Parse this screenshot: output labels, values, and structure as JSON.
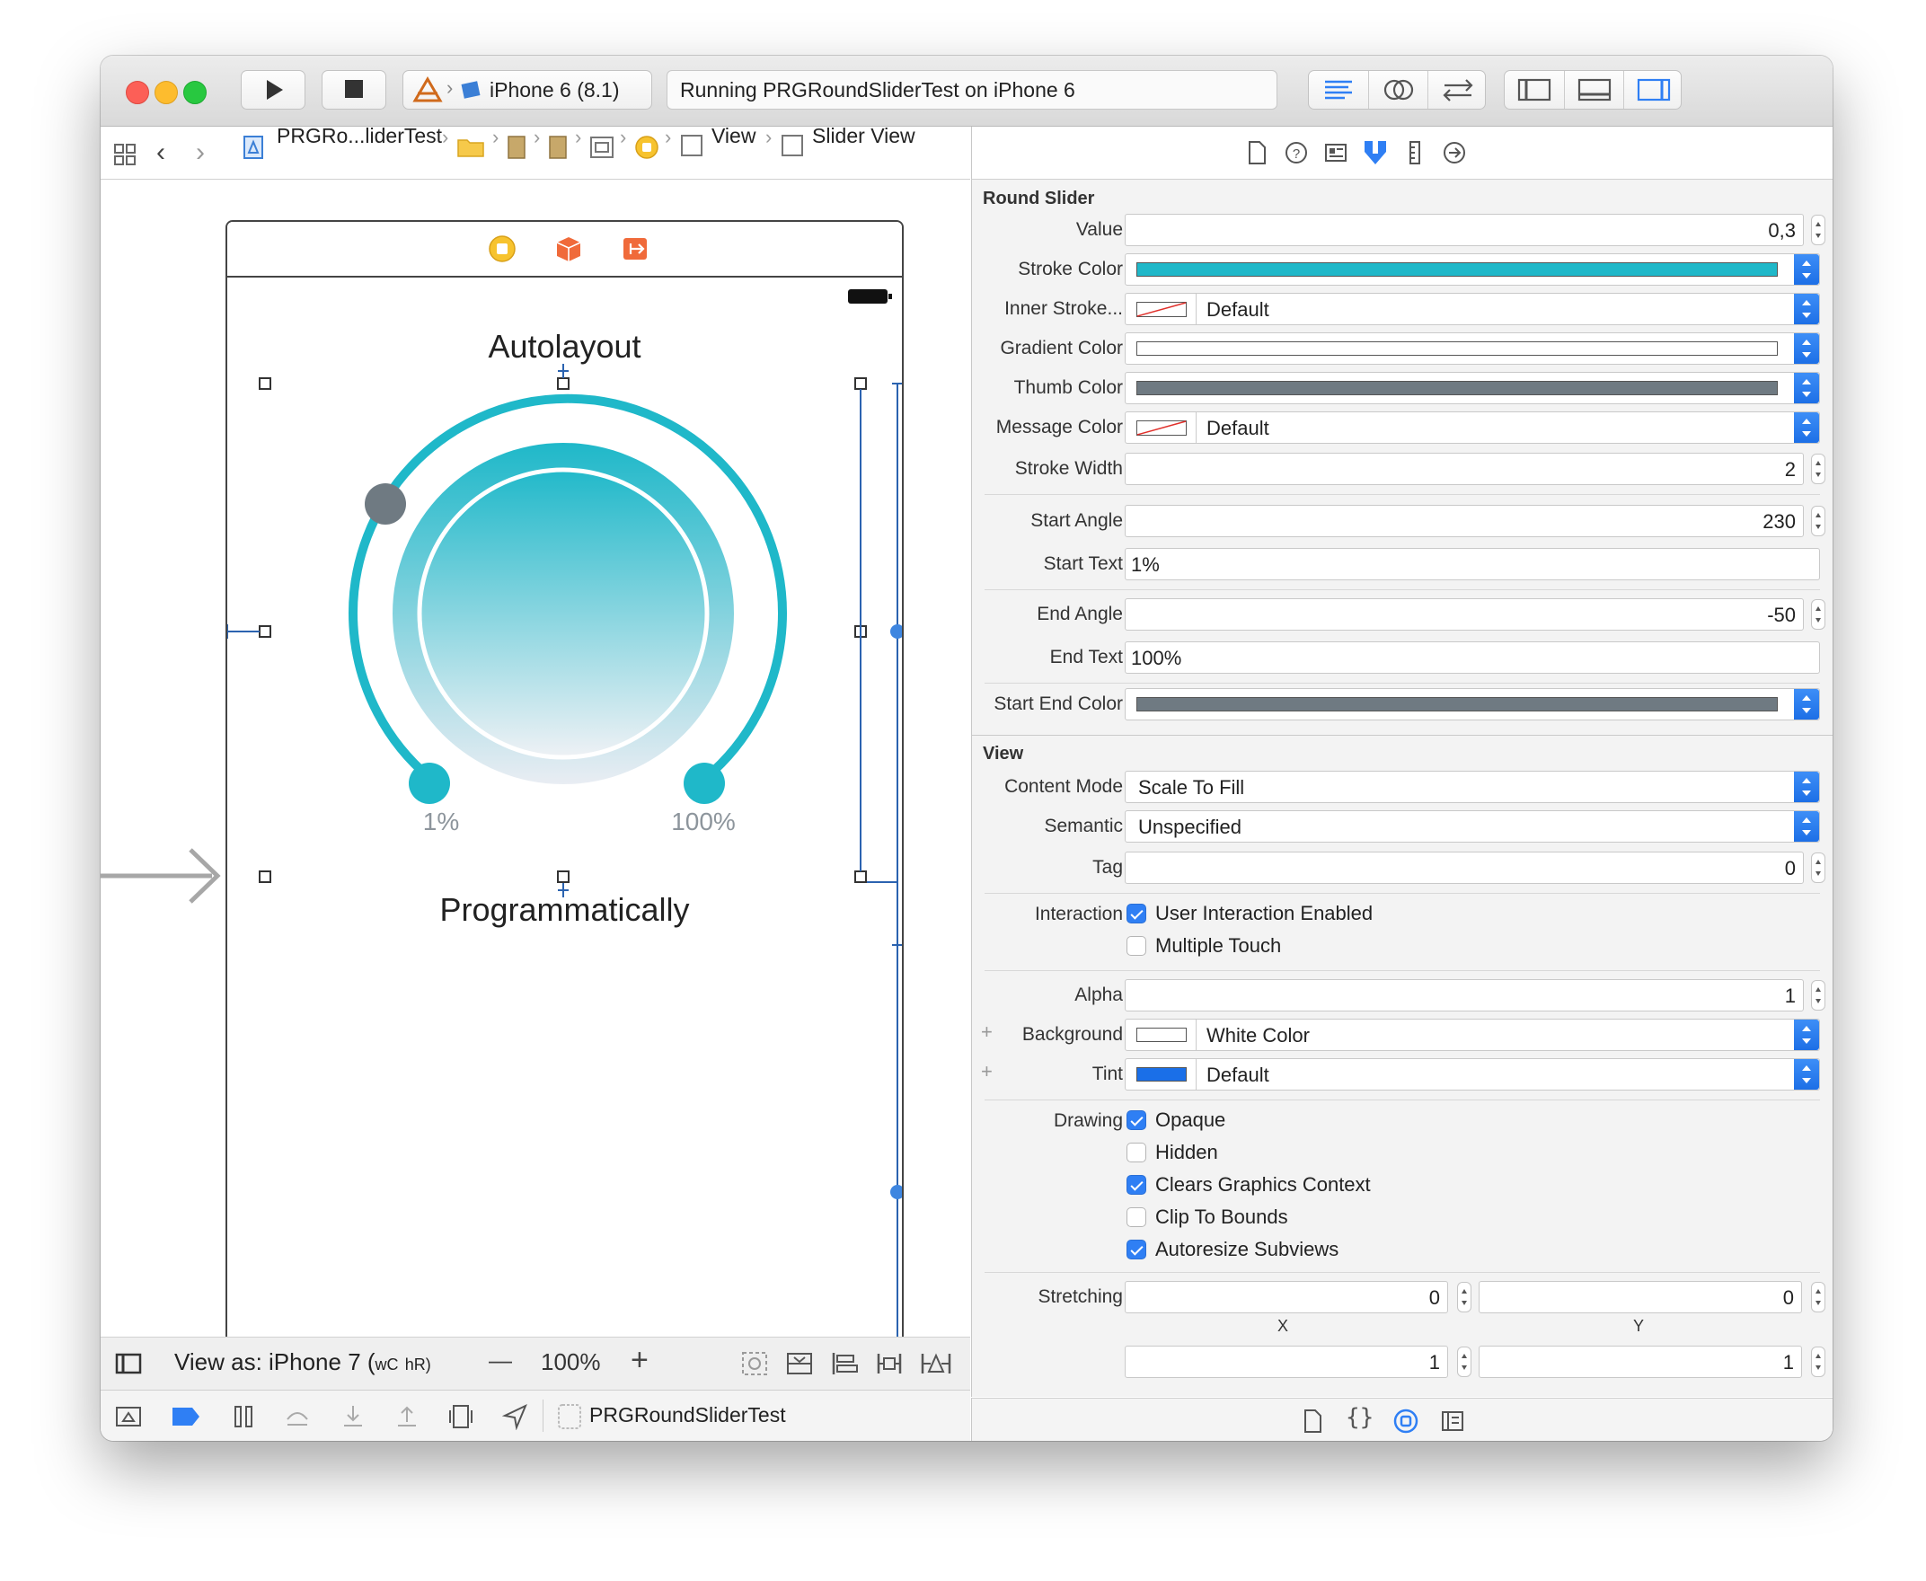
{
  "toolbar": {
    "scheme": "iPhone 6 (8.1)",
    "status": "Running PRGRoundSliderTest on iPhone 6"
  },
  "jumpbar": {
    "project": "PRGRo...liderTest",
    "view": "View",
    "slider_view": "Slider View"
  },
  "canvas": {
    "title_top": "Autolayout",
    "start_label": "1%",
    "end_label": "100%",
    "title_bottom": "Programmatically"
  },
  "bottombar": {
    "view_as": "View as: iPhone 7 (",
    "wc": "wC",
    "hr": "hR)",
    "minus": "—",
    "zoom": "100%",
    "plus": "+"
  },
  "debugbar": {
    "target": "PRGRoundSliderTest"
  },
  "inspector": {
    "round_slider": {
      "section": "Round Slider",
      "value_label": "Value",
      "value": "0,3",
      "stroke_color_label": "Stroke Color",
      "inner_stroke_label": "Inner Stroke...",
      "inner_stroke": "Default",
      "gradient_color_label": "Gradient Color",
      "thumb_color_label": "Thumb Color",
      "message_color_label": "Message Color",
      "message_color": "Default",
      "stroke_width_label": "Stroke Width",
      "stroke_width": "2",
      "start_angle_label": "Start Angle",
      "start_angle": "230",
      "start_text_label": "Start Text",
      "start_text": "1%",
      "end_angle_label": "End Angle",
      "end_angle": "-50",
      "end_text_label": "End Text",
      "end_text": "100%",
      "start_end_color_label": "Start End Color"
    },
    "view": {
      "section": "View",
      "content_mode_label": "Content Mode",
      "content_mode": "Scale To Fill",
      "semantic_label": "Semantic",
      "semantic": "Unspecified",
      "tag_label": "Tag",
      "tag": "0",
      "interaction_label": "Interaction",
      "user_interaction": "User Interaction Enabled",
      "multiple_touch": "Multiple Touch",
      "alpha_label": "Alpha",
      "alpha": "1",
      "background_label": "Background",
      "background": "White Color",
      "tint_label": "Tint",
      "tint": "Default",
      "drawing_label": "Drawing",
      "opaque": "Opaque",
      "hidden": "Hidden",
      "clears_context": "Clears Graphics Context",
      "clip_bounds": "Clip To Bounds",
      "autoresize": "Autoresize Subviews",
      "stretching_label": "Stretching",
      "stretch_x": "0",
      "stretch_y": "0",
      "x_label": "X",
      "y_label": "Y",
      "stretch_w": "1",
      "stretch_h": "1"
    }
  },
  "colors": {
    "stroke": "#1fb8c9",
    "thumb": "#6f7a82",
    "tint": "#1a6fe8",
    "accent": "#2f7ff4"
  }
}
